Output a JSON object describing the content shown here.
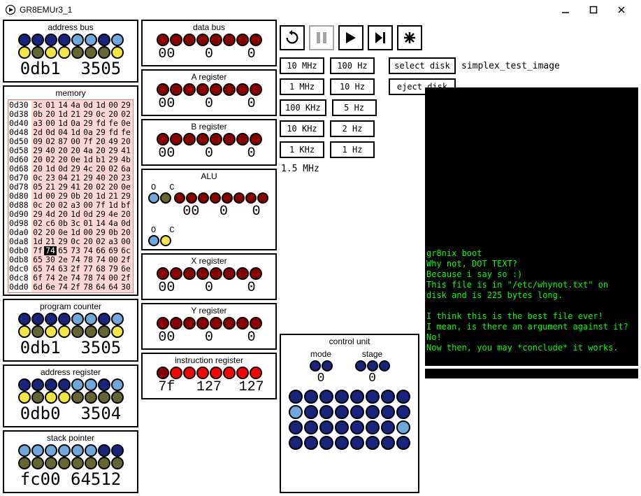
{
  "window": {
    "title": "GR8EMUr3_1"
  },
  "toolbar": {
    "reset": "reset",
    "pause": "pause",
    "play": "play",
    "step": "step",
    "break": "break"
  },
  "freq": {
    "rows": [
      [
        "10 MHz",
        "100 Hz"
      ],
      [
        "1 MHz",
        "10 Hz"
      ],
      [
        "100 KHz",
        "5 Hz"
      ],
      [
        "10 KHz",
        "2 Hz"
      ],
      [
        "1 KHz",
        "1 Hz"
      ]
    ],
    "select_disk": "select disk",
    "eject_disk": "eject disk",
    "disk_name": "simplex_test_image",
    "current": "1.5 MHz"
  },
  "panels": {
    "address_bus": {
      "title": "address bus",
      "value": "0db1  3505",
      "row1": [
        "dblue",
        "dblue",
        "dblue",
        "dblue",
        "blue",
        "blue",
        "dblue",
        "blue"
      ],
      "row2": [
        "yellow",
        "olive",
        "yellow",
        "yellow",
        "olive",
        "olive",
        "olive",
        "yellow"
      ]
    },
    "data_bus": {
      "title": "data bus",
      "hex": "00",
      "d1": "0",
      "d2": "0",
      "row": [
        "red",
        "red",
        "red",
        "red",
        "red",
        "red",
        "red",
        "red"
      ]
    },
    "a_reg": {
      "title": "A register",
      "hex": "00",
      "d1": "0",
      "d2": "0",
      "row": [
        "red",
        "red",
        "red",
        "red",
        "red",
        "red",
        "red",
        "red"
      ]
    },
    "b_reg": {
      "title": "B register",
      "hex": "00",
      "d1": "0",
      "d2": "0",
      "row": [
        "red",
        "red",
        "red",
        "red",
        "red",
        "red",
        "red",
        "red"
      ]
    },
    "alu": {
      "title": "ALU",
      "o": "O",
      "c": "C",
      "hex": "00",
      "d1": "0",
      "d2": "0",
      "flags": [
        "blue",
        "olive"
      ],
      "row": [
        "red",
        "red",
        "red",
        "red",
        "red",
        "red",
        "red",
        "red"
      ],
      "flags2": [
        "blue",
        "yellow"
      ]
    },
    "pc": {
      "title": "program counter",
      "value": "0db1  3505",
      "row1": [
        "dblue",
        "dblue",
        "dblue",
        "dblue",
        "blue",
        "blue",
        "dblue",
        "blue"
      ],
      "row2": [
        "yellow",
        "olive",
        "yellow",
        "yellow",
        "olive",
        "olive",
        "olive",
        "yellow"
      ]
    },
    "ar": {
      "title": "address register",
      "value": "0db0  3504",
      "row1": [
        "dblue",
        "dblue",
        "dblue",
        "dblue",
        "blue",
        "blue",
        "dblue",
        "blue"
      ],
      "row2": [
        "yellow",
        "olive",
        "yellow",
        "yellow",
        "olive",
        "olive",
        "olive",
        "olive"
      ]
    },
    "sp": {
      "title": "stack pointer",
      "value": "fc00 64512",
      "row1": [
        "blue",
        "blue",
        "blue",
        "blue",
        "blue",
        "blue",
        "dblue",
        "dblue"
      ],
      "row2": [
        "olive",
        "olive",
        "olive",
        "olive",
        "olive",
        "olive",
        "olive",
        "olive"
      ]
    },
    "x_reg": {
      "title": "X register",
      "hex": "00",
      "d1": "0",
      "d2": "0",
      "row": [
        "red",
        "red",
        "red",
        "red",
        "red",
        "red",
        "red",
        "red"
      ]
    },
    "y_reg": {
      "title": "Y register",
      "hex": "00",
      "d1": "0",
      "d2": "0",
      "row": [
        "red",
        "red",
        "red",
        "red",
        "red",
        "red",
        "red",
        "red"
      ]
    },
    "ir": {
      "title": "instruction register",
      "hex": "7f",
      "d1": "127",
      "d2": "127",
      "row": [
        "red",
        "bred",
        "bred",
        "bred",
        "bred",
        "bred",
        "bred",
        "bred"
      ]
    },
    "cu": {
      "title": "control unit",
      "mode": "mode",
      "stage": "stage",
      "mode_leds": [
        "dblue",
        "dblue"
      ],
      "mode_val": "0",
      "stage_leds": [
        "dblue",
        "dblue",
        "dblue"
      ],
      "stage_val": "0",
      "grid": [
        [
          "dblue",
          "dblue",
          "dblue",
          "dblue",
          "dblue",
          "dblue",
          "dblue",
          "dblue"
        ],
        [
          "blue",
          "dblue",
          "dblue",
          "dblue",
          "dblue",
          "dblue",
          "dblue",
          "dblue"
        ],
        [
          "dblue",
          "dblue",
          "dblue",
          "dblue",
          "dblue",
          "dblue",
          "dblue",
          "blue"
        ],
        [
          "dblue",
          "dblue",
          "dblue",
          "dblue",
          "dblue",
          "dblue",
          "dblue",
          "dblue"
        ]
      ]
    }
  },
  "memory": {
    "title": "memory",
    "rows": [
      {
        "addr": "0d30",
        "cells": [
          "3c",
          "01",
          "14",
          "4a",
          "0d",
          "1d",
          "00",
          "29"
        ]
      },
      {
        "addr": "0d38",
        "cells": [
          "0b",
          "20",
          "1d",
          "21",
          "29",
          "0c",
          "20",
          "02"
        ]
      },
      {
        "addr": "0d40",
        "cells": [
          "a3",
          "00",
          "1d",
          "0a",
          "29",
          "fd",
          "fe",
          "0e"
        ]
      },
      {
        "addr": "0d48",
        "cells": [
          "2d",
          "0d",
          "04",
          "1d",
          "0a",
          "29",
          "fd",
          "fe"
        ]
      },
      {
        "addr": "0d50",
        "cells": [
          "09",
          "02",
          "87",
          "00",
          "7f",
          "20",
          "49",
          "20"
        ]
      },
      {
        "addr": "0d58",
        "cells": [
          "29",
          "40",
          "20",
          "20",
          "4a",
          "20",
          "29",
          "41"
        ]
      },
      {
        "addr": "0d60",
        "cells": [
          "20",
          "02",
          "20",
          "0e",
          "1d",
          "b1",
          "29",
          "4b"
        ]
      },
      {
        "addr": "0d68",
        "cells": [
          "20",
          "1d",
          "0d",
          "29",
          "4c",
          "20",
          "02",
          "6a"
        ]
      },
      {
        "addr": "0d70",
        "cells": [
          "0c",
          "23",
          "04",
          "21",
          "29",
          "40",
          "20",
          "23"
        ]
      },
      {
        "addr": "0d78",
        "cells": [
          "05",
          "21",
          "29",
          "41",
          "20",
          "02",
          "20",
          "0e"
        ]
      },
      {
        "addr": "0d80",
        "cells": [
          "1d",
          "00",
          "29",
          "0b",
          "20",
          "1d",
          "21",
          "29"
        ]
      },
      {
        "addr": "0d88",
        "cells": [
          "0c",
          "20",
          "02",
          "a3",
          "00",
          "7f",
          "1d",
          "bf"
        ]
      },
      {
        "addr": "0d90",
        "cells": [
          "29",
          "4d",
          "20",
          "1d",
          "0d",
          "29",
          "4e",
          "20"
        ]
      },
      {
        "addr": "0d98",
        "cells": [
          "02",
          "c6",
          "0b",
          "3c",
          "01",
          "14",
          "4a",
          "0d"
        ]
      },
      {
        "addr": "0da0",
        "cells": [
          "02",
          "20",
          "0e",
          "1d",
          "00",
          "29",
          "0b",
          "20"
        ]
      },
      {
        "addr": "0da8",
        "cells": [
          "1d",
          "21",
          "29",
          "0c",
          "20",
          "02",
          "a3",
          "00"
        ]
      },
      {
        "addr": "0db0",
        "cells": [
          "7f",
          "74",
          "65",
          "73",
          "74",
          "66",
          "69",
          "6c"
        ],
        "hl": 1
      },
      {
        "addr": "0db8",
        "cells": [
          "65",
          "30",
          "2e",
          "74",
          "78",
          "74",
          "00",
          "2f"
        ]
      },
      {
        "addr": "0dc0",
        "cells": [
          "65",
          "74",
          "63",
          "2f",
          "77",
          "68",
          "79",
          "6e"
        ]
      },
      {
        "addr": "0dc8",
        "cells": [
          "6f",
          "74",
          "2e",
          "74",
          "78",
          "74",
          "00",
          "2f"
        ]
      },
      {
        "addr": "0dd0",
        "cells": [
          "6d",
          "6e",
          "74",
          "2f",
          "78",
          "64",
          "64",
          "30"
        ]
      }
    ]
  },
  "screen": {
    "lines": [
      "gr8nix boot",
      "Why not, DOT TEXT?",
      "Because i say so :)",
      "This file is in \"/etc/whynot.txt\" on",
      "disk and is 225 bytes long.",
      "",
      "I think this is the best file ever!",
      "I mean, is there an argument against it?",
      "No!",
      "Now then, you may *conclude* it works."
    ]
  }
}
